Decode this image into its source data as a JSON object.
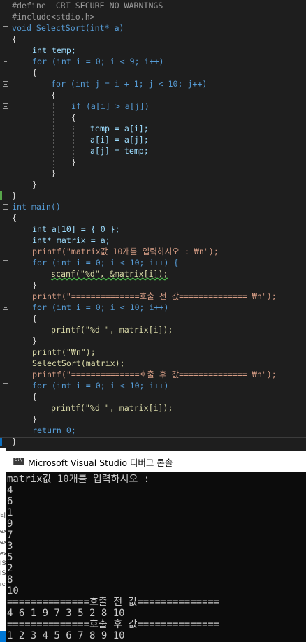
{
  "editor": {
    "lines": [
      "#define _CRT_SECURE_NO_WARNINGS",
      "#include<stdio.h>",
      "void SelectSort(int* a)",
      "{",
      "int temp;",
      "for (int i = 0; i < 9; i++)",
      "{",
      "for (int j = i + 1; j < 10; j++)",
      "{",
      "if (a[i] > a[j])",
      "{",
      "temp = a[i];",
      "a[i] = a[j];",
      "a[j] = temp;",
      "}",
      "}",
      "}",
      "}",
      "int main()",
      "{",
      "int a[10] = { 0 };",
      "int* matrix = a;",
      "printf(\"matrix값 10개를 입력하시오 : ₩n\");",
      "for (int i = 0; i < 10; i++) {",
      "scanf(\"%d\", &matrix[i]);",
      "}",
      "printf(\"==============호출 전 값============== ₩n\");",
      "for (int i = 0; i < 10; i++)",
      "{",
      "printf(\"%d \", matrix[i]);",
      "}",
      "printf(\"₩n\");",
      "SelectSort(matrix);",
      "printf(\"==============호출 후 값============== ₩n\");",
      "for (int i = 0; i < 10; i++)",
      "{",
      "printf(\"%d \", matrix[i]);",
      "}",
      "return 0;",
      "}"
    ]
  },
  "console_window": {
    "title": "Microsoft Visual Studio 디버그 콘솔",
    "icon": "console-app-icon"
  },
  "console": {
    "lines": [
      "matrix값 10개를 입력하시오 :",
      "4",
      "6",
      "1",
      "9",
      "7",
      "3",
      "5",
      "2",
      "8",
      "10",
      "==============호출 전 값==============",
      "4 6 1 9 7 3 5 2 8 10",
      "==============호출 후 값==============",
      "1 2 3 4 5 6 7 8 9 10"
    ]
  },
  "background_window": {
    "fragments": [
      "티",
      "ex",
      "ex",
      "ex",
      "IS",
      "IS",
      "rc"
    ]
  },
  "colors": {
    "editor_bg": "#1e1e1e",
    "keyword": "#569cd6",
    "function": "#dcdcaa",
    "string": "#d69d85",
    "variable": "#9cdcfe",
    "number": "#b5cea8",
    "preprocessor": "#9b9b9b",
    "console_bg": "#0c0c0c",
    "console_text": "#cccccc"
  }
}
